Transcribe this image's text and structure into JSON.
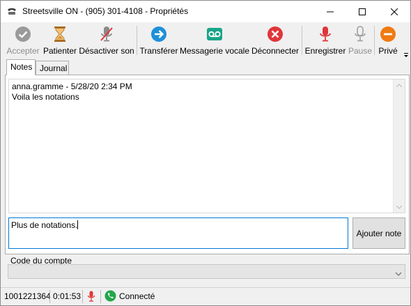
{
  "window": {
    "title": "Streetsville ON - (905) 301-4108 - Propriétés",
    "app_icon": "phone-handset-icon"
  },
  "toolbar": {
    "buttons": [
      {
        "label": "Accepter",
        "icon": "check-circle-icon",
        "color": "#9a9a9a",
        "enabled": false
      },
      {
        "label": "Patienter",
        "icon": "hourglass-icon",
        "color": "#d89b3a",
        "enabled": true
      },
      {
        "label": "Désactiver son",
        "icon": "mic-muted-icon",
        "color": "#8a8a8a",
        "enabled": true
      },
      {
        "label": "Transférer",
        "icon": "arrow-right-circle-icon",
        "color": "#1e90d8",
        "enabled": true
      },
      {
        "label": "Messagerie vocale",
        "icon": "voicemail-icon",
        "color": "#1aa58a",
        "enabled": true
      },
      {
        "label": "Déconnecter",
        "icon": "close-circle-icon",
        "color": "#e0353a",
        "enabled": true
      },
      {
        "label": "Enregistrer",
        "icon": "mic-record-icon",
        "color": "#e0353a",
        "enabled": true
      },
      {
        "label": "Pause",
        "icon": "mic-pause-icon",
        "color": "#a0a0a0",
        "enabled": false
      },
      {
        "label": "Privé",
        "icon": "private-minus-icon",
        "color": "#f07a12",
        "enabled": true
      }
    ]
  },
  "tabs": [
    {
      "label": "Notes",
      "active": true
    },
    {
      "label": "Journal",
      "active": false
    }
  ],
  "notes": {
    "lines": [
      "anna.gramme - 5/28/20 2:34 PM",
      "Voila les notations"
    ],
    "input_value": "Plus de notations.",
    "add_button_label": "Ajouter note"
  },
  "account": {
    "label": "Code du compte",
    "selected_value": ""
  },
  "status": {
    "call_id": "1001221364",
    "duration": "0:01:53",
    "mic_icon": "microphone-icon",
    "state_icon": "phone-connected-icon",
    "state_label": "Connecté",
    "connected_color": "#22a64a"
  }
}
